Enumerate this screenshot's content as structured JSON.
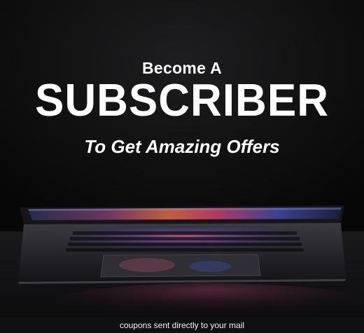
{
  "banner": {
    "heading_top": "Become A",
    "heading_main": "SUBSCRIBER",
    "heading_sub": "To Get Amazing Offers",
    "caption": "coupons sent directly to your mail"
  },
  "colors": {
    "background": "#0b0b0c",
    "text": "#ffffff",
    "glow_pink": "#e0367a",
    "glow_orange": "#e88a3a",
    "glow_blue": "#4a6cff"
  }
}
